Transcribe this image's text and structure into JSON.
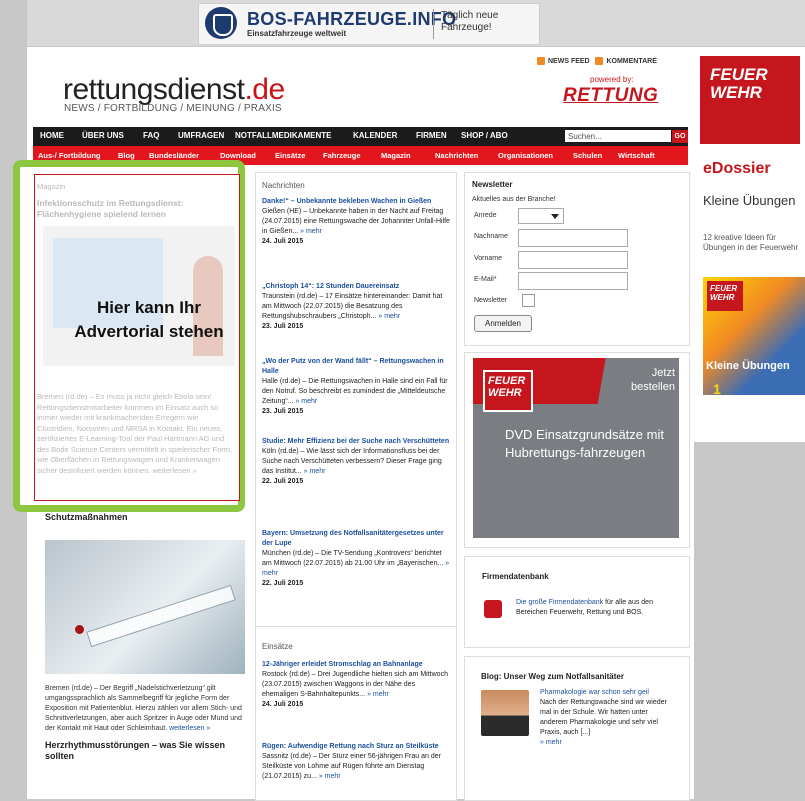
{
  "banner": {
    "title": "BOS-FAHRZEUGE.INFO",
    "subtitle": "Einsatzfahrzeuge weltweit",
    "right": "Täglich neue Fahrzeuge!"
  },
  "header": {
    "logo_main": "rettungsdienst",
    "logo_tld": ".de",
    "tagline": "NEWS / FORTBILDUNG / MEINUNG / PRAXIS",
    "newsfeed": "NEWS FEED",
    "kommentare": "KOMMENTARE",
    "powered_by": "powered by:",
    "rettung": "RETTUNG"
  },
  "nav_main": [
    "HOME",
    "ÜBER UNS",
    "FAQ",
    "UMFRAGEN",
    "NOTFALLMEDIKAMENTE",
    "KALENDER",
    "FIRMEN",
    "SHOP / ABO"
  ],
  "search": {
    "value": "Suchen...",
    "go": "GO"
  },
  "nav_sub": [
    "Aus-/ Fortbildung",
    "Blog",
    "Bundesländer",
    "Download",
    "Einsätze",
    "Fahrzeuge",
    "Magazin",
    "Nachrichten",
    "Organisationen",
    "Schulen",
    "Wirtschaft"
  ],
  "advertorial": {
    "section": "Magazin",
    "headline": "Infektionsschutz im Rettungsdienst: Flächenhygiene spielend lernen",
    "overlay": "Hier kann Ihr Advertorial stehen",
    "body": "Bremen (rd.de) – Es muss ja nicht gleich Ebola sein! Rettungsdienstmitarbeiter kommen im Einsatz auch so immer wieder mit krankmachenden Erregern wie Clostridien, Noroviren und MRSA in Kontakt. Ein neues, zertifiziertes E-Learning-Tool der Paul Hartmann AG und des Bode Science Centers vermittelt in spielerischer Form, wie Oberflächen in Rettungswagen und Krankenwagen sicher desinfiziert werden können.",
    "more": "weiterlesen »"
  },
  "left": {
    "heading": "Schutzmaßnahmen",
    "body": "Bremen (rd.de) – Der Begriff „Nadelstichverletzung“ gilt umgangssprachlich als Sammelbegriff für jegliche Form der Exposition mit Patientenblut. Hierzu zählen vor allem Stich- und Schnittverletzungen, aber auch Spritzer in Auge oder Mund und der Kontakt mit Haut oder Schleimhaut.",
    "more": "weiterlesen »",
    "heading2": "Herzrhythmusstörungen – was Sie wissen sollten"
  },
  "news": {
    "section": "Nachrichten",
    "items": [
      {
        "title": "Danke!“ – Unbekannte bekleben Wachen in Gießen",
        "body": "Gießen (HE) – Unbekannte haben in der Nacht auf Freitag (24.07.2015) eine Rettungswache der Johanniter Unfall-Hilfe in Gießen...",
        "more": "» mehr",
        "date": "24. Juli 2015"
      },
      {
        "title": "„Christoph 14“: 12 Stunden Dauereinsatz",
        "body": "Traunstein (rd.de) – 17 Einsätze hintereinander: Damit hat am Mittwoch (22.07.2015) die Besatzung des Rettungshubschraubers „Christoph...",
        "more": "» mehr",
        "date": "23. Juli 2015"
      },
      {
        "title": "„Wo der Putz von der Wand fällt“ – Rettungswachen in Halle",
        "body": "Halle (rd.de) – Die Rettungswachen in Halle sind ein Fall für den Notruf. So beschreibt es zumindest die „Mitteldeutsche Zeitung“...",
        "more": "» mehr",
        "date": "23. Juli 2015"
      },
      {
        "title": "Studie: Mehr Effizienz bei der Suche nach Verschütteten",
        "body": "Köln (rd.de) – Wie lässt sich der Informationsfluss bei der Suche nach Verschütteten verbessern? Dieser Frage ging das Institut...",
        "more": "» mehr",
        "date": "22. Juli 2015"
      },
      {
        "title": "Bayern: Umsetzung des Notfallsanitätergesetzes unter der Lupe",
        "body": "München (rd.de) – Die TV-Sendung „Kontrovers“ berichtet am Mittwoch (22.07.2015) ab 21.00 Uhr im „Bayerischen...",
        "more": "» mehr",
        "date": "22. Juli 2015"
      }
    ]
  },
  "einsaetze": {
    "section": "Einsätze",
    "items": [
      {
        "title": "12-Jähriger erleidet Stromschlag an Bahnanlage",
        "body": "Rostock (rd.de) – Drei Jugendliche hielten sich am Mittwoch (23.07.2015) zwischen Waggons in der Nähe des ehemaligen S-Bahnhaltepunkts...",
        "more": "» mehr",
        "date": "24. Juli 2015"
      },
      {
        "title": "Rügen: Aufwendige Rettung nach Sturz an Steilküste",
        "body": "Sassnitz (rd.de) – Der Sturz einer 56-jährigen Frau an der Steilküste von Lohme auf Rügen führte am Dienstag (21.07.2015) zu...",
        "more": "» mehr",
        "date": ""
      }
    ]
  },
  "newsletter": {
    "title": "Newsletter",
    "subtitle": "Aktuelles aus der Branche!",
    "anrede": "Anrede",
    "nachname": "Nachname",
    "vorname": "Vorname",
    "email": "E-Mail*",
    "newsletter": "Newsletter",
    "submit": "Anmelden"
  },
  "dvd_ad": {
    "brand": "FEUER WEHR",
    "cta": "Jetzt bestellen",
    "text": "DVD Einsatzgrundsätze mit Hubrettungs-fahrzeugen"
  },
  "firmen": {
    "title": "Firmendatenbank",
    "link": "Die große Firmendatenbank",
    "text": " für alle aus den Bereichen Feuerwehr, Rettung und BOS."
  },
  "blog": {
    "title": "Blog: Unser Weg zum Notfallsanitäter",
    "link": "Pharmakologie war schon sehr geil",
    "text": "Nach der Rettungswache sind wir wieder mal in der Schule. Wir hatten unter anderem Pharmakologie und sehr viel Praxis, auch [...]",
    "more": "» mehr"
  },
  "right_ad": {
    "brand": "FEUER WEHR",
    "edossier": "eDossier",
    "title": "Kleine Übungen",
    "sub": "12 kreative Ideen für Übungen in der Feuerwehr",
    "cover": "Kleine Übungen",
    "num": "1"
  }
}
